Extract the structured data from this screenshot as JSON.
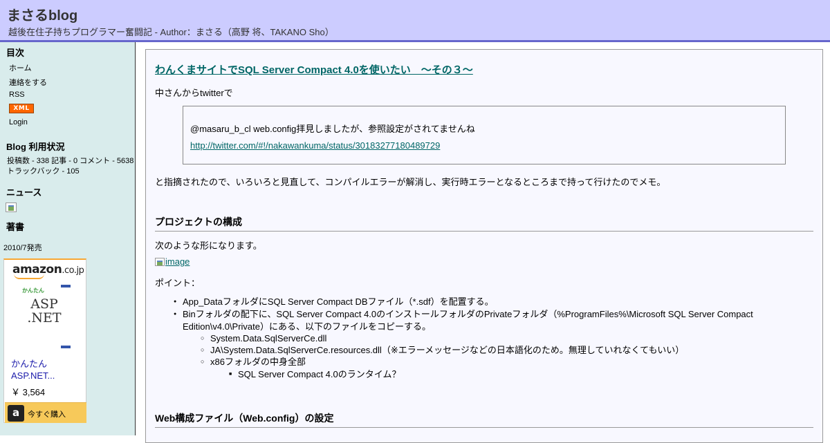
{
  "header": {
    "title": "まさるblog",
    "description": "越後在住子持ちプログラマー奮闘記 - Author：まさる（高野 将、TAKANO Sho）"
  },
  "sidebar": {
    "toc_heading": "目次",
    "links": [
      "ホーム",
      "連絡をする",
      "RSS"
    ],
    "xml_badge": "XML",
    "login": "Login",
    "stats_heading": "Blog 利用状況",
    "stats_line1": "投稿数 - 338 記事 - 0 コメント - 5638",
    "stats_line2": "トラックバック - 105",
    "news_heading": "ニュース",
    "books_heading": "著書",
    "release": "2010/7発売",
    "amazon": {
      "logo": "amazon",
      "logo_suffix": ".co.jp",
      "cover_tag": "かんたん",
      "cover_title": "ASP\n.NET",
      "book_name_1": "かんたん",
      "book_name_2": "ASP.NET...",
      "price": "￥ 3,564",
      "buy_icon": "a",
      "buy_label": "今すぐ購入"
    }
  },
  "post": {
    "title": "わんくまサイトでSQL Server Compact 4.0を使いたい　～その３～",
    "intro": "中さんからtwitterで",
    "quote_text": "@masaru_b_cl web.config拝見しましたが、参照設定がされてませんね",
    "quote_link": "http://twitter.com/#!/nakawankuma/status/30183277180489729",
    "after_quote": "と指摘されたので、いろいろと見直して、コンパイルエラーが解消し、実行時エラーとなるところまで持って行けたのでメモ。",
    "section1": "プロジェクトの構成",
    "section1_intro": "次のような形になります。",
    "image_alt": "image",
    "points_label": "ポイント：",
    "bullets": [
      "App_DataフォルダにSQL Server Compact DBファイル（*.sdf）を配置する。",
      "Binフォルダの配下に、SQL Server Compact 4.0のインストールフォルダのPrivateフォルダ（%ProgramFiles%\\Microsoft SQL Server Compact",
      "Edition\\v4.0\\Private）にある、以下のファイルをコピーする。"
    ],
    "sub_bullets": [
      "System.Data.SqlServerCe.dll",
      "JA\\System.Data.SqlServerCe.resources.dll（※エラーメッセージなどの日本語化のため。無理していれなくてもいい）",
      "x86フォルダの中身全部"
    ],
    "sub_sub_bullets": [
      "SQL Server Compact 4.0のランタイム？"
    ],
    "section2": "Web構成ファイル（Web.config）の設定"
  }
}
